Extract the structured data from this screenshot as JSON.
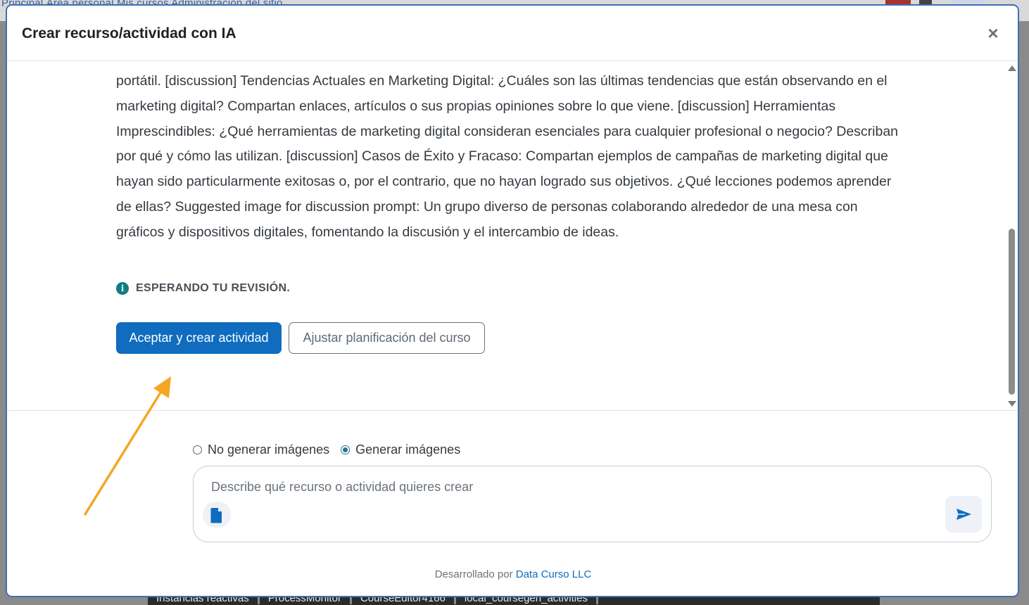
{
  "background": {
    "nav_text": "Principal   Área personal   Mis cursos   Administración del sitio",
    "bottom_tabs": [
      "Instancias reactivas",
      "ProcessMonitor",
      "CourseEditor4166",
      "local_coursegen_activities"
    ]
  },
  "modal": {
    "title": "Crear recurso/actividad con IA",
    "close_label": "×",
    "body_text": "portátil. [discussion] Tendencias Actuales en Marketing Digital: ¿Cuáles son las últimas tendencias que están observando en el marketing digital? Compartan enlaces, artículos o sus propias opiniones sobre lo que viene. [discussion] Herramientas Imprescindibles: ¿Qué herramientas de marketing digital consideran esenciales para cualquier profesional o negocio? Describan por qué y cómo las utilizan. [discussion] Casos de Éxito y Fracaso: Compartan ejemplos de campañas de marketing digital que hayan sido particularmente exitosas o, por el contrario, que no hayan logrado sus objetivos. ¿Qué lecciones podemos aprender de ellas? Suggested image for discussion prompt: Un grupo diverso de personas colaborando alrededor de una mesa con gráficos y dispositivos digitales, fomentando la discusión y el intercambio de ideas.",
    "status_icon": "info-icon",
    "status_text": "ESPERANDO TU REVISIÓN.",
    "accept_button": "Aceptar y crear actividad",
    "adjust_button": "Ajustar planificación del curso"
  },
  "image_options": {
    "options": [
      {
        "label": "No generar imágenes",
        "checked": false
      },
      {
        "label": "Generar imágenes",
        "checked": true
      }
    ]
  },
  "prompt": {
    "placeholder": "Describe qué recurso o actividad quieres crear",
    "value": "",
    "attach_icon": "file-icon",
    "send_icon": "send-icon"
  },
  "footer": {
    "prefix": "Desarrollado por",
    "link_text": "Data Curso LLC"
  },
  "colors": {
    "primary": "#0f6cbf",
    "annotation_arrow": "#f5a623",
    "modal_border": "#3d6fb6"
  }
}
